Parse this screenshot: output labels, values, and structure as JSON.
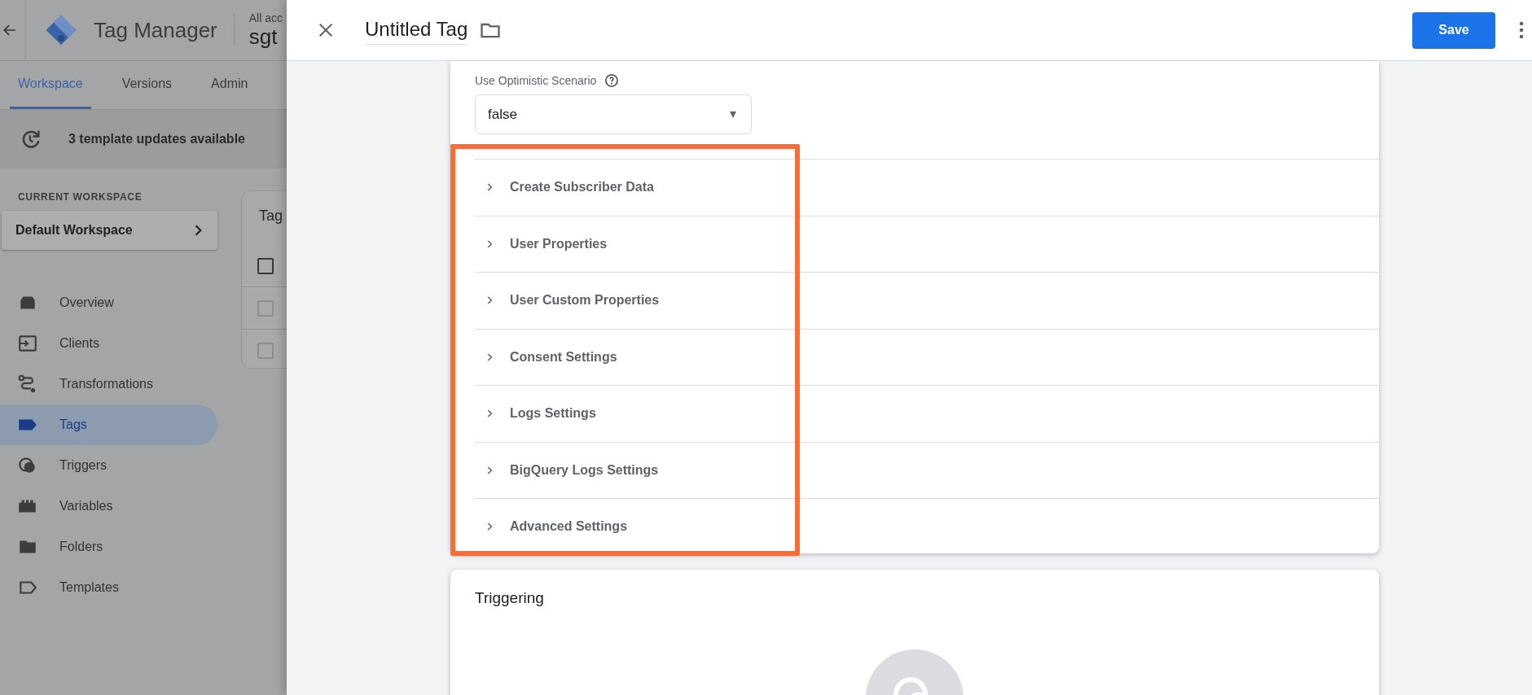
{
  "app": {
    "product": "Tag Manager",
    "account_label": "All acc",
    "container_name": "sgt",
    "tabs": [
      {
        "label": "Workspace",
        "selected": true
      },
      {
        "label": "Versions",
        "selected": false
      },
      {
        "label": "Admin",
        "selected": false
      }
    ],
    "banner": "3 template updates available",
    "workspace_heading": "CURRENT WORKSPACE",
    "workspace": "Default Workspace",
    "nav": [
      {
        "label": "Overview",
        "selected": false
      },
      {
        "label": "Clients",
        "selected": false
      },
      {
        "label": "Transformations",
        "selected": false
      },
      {
        "label": "Tags",
        "selected": true
      },
      {
        "label": "Triggers",
        "selected": false
      },
      {
        "label": "Variables",
        "selected": false
      },
      {
        "label": "Folders",
        "selected": false
      },
      {
        "label": "Templates",
        "selected": false
      }
    ],
    "tag_list": {
      "title": "Tag",
      "checkboxes": [
        {
          "checked": false,
          "kind": "header"
        },
        {
          "checked": false,
          "kind": "row"
        },
        {
          "checked": false,
          "kind": "row"
        }
      ]
    }
  },
  "panel": {
    "title": "Untitled Tag",
    "save": "Save",
    "field": {
      "label": "Use Optimistic Scenario",
      "value": "false"
    },
    "sections": [
      {
        "label": "Create Subscriber Data",
        "expanded": false
      },
      {
        "label": "User Properties",
        "expanded": false
      },
      {
        "label": "User Custom Properties",
        "expanded": false
      },
      {
        "label": "Consent Settings",
        "expanded": false
      },
      {
        "label": "Logs Settings",
        "expanded": false
      },
      {
        "label": "BigQuery Logs Settings",
        "expanded": false
      },
      {
        "label": "Advanced Settings",
        "expanded": false
      }
    ],
    "triggering_title": "Triggering"
  }
}
